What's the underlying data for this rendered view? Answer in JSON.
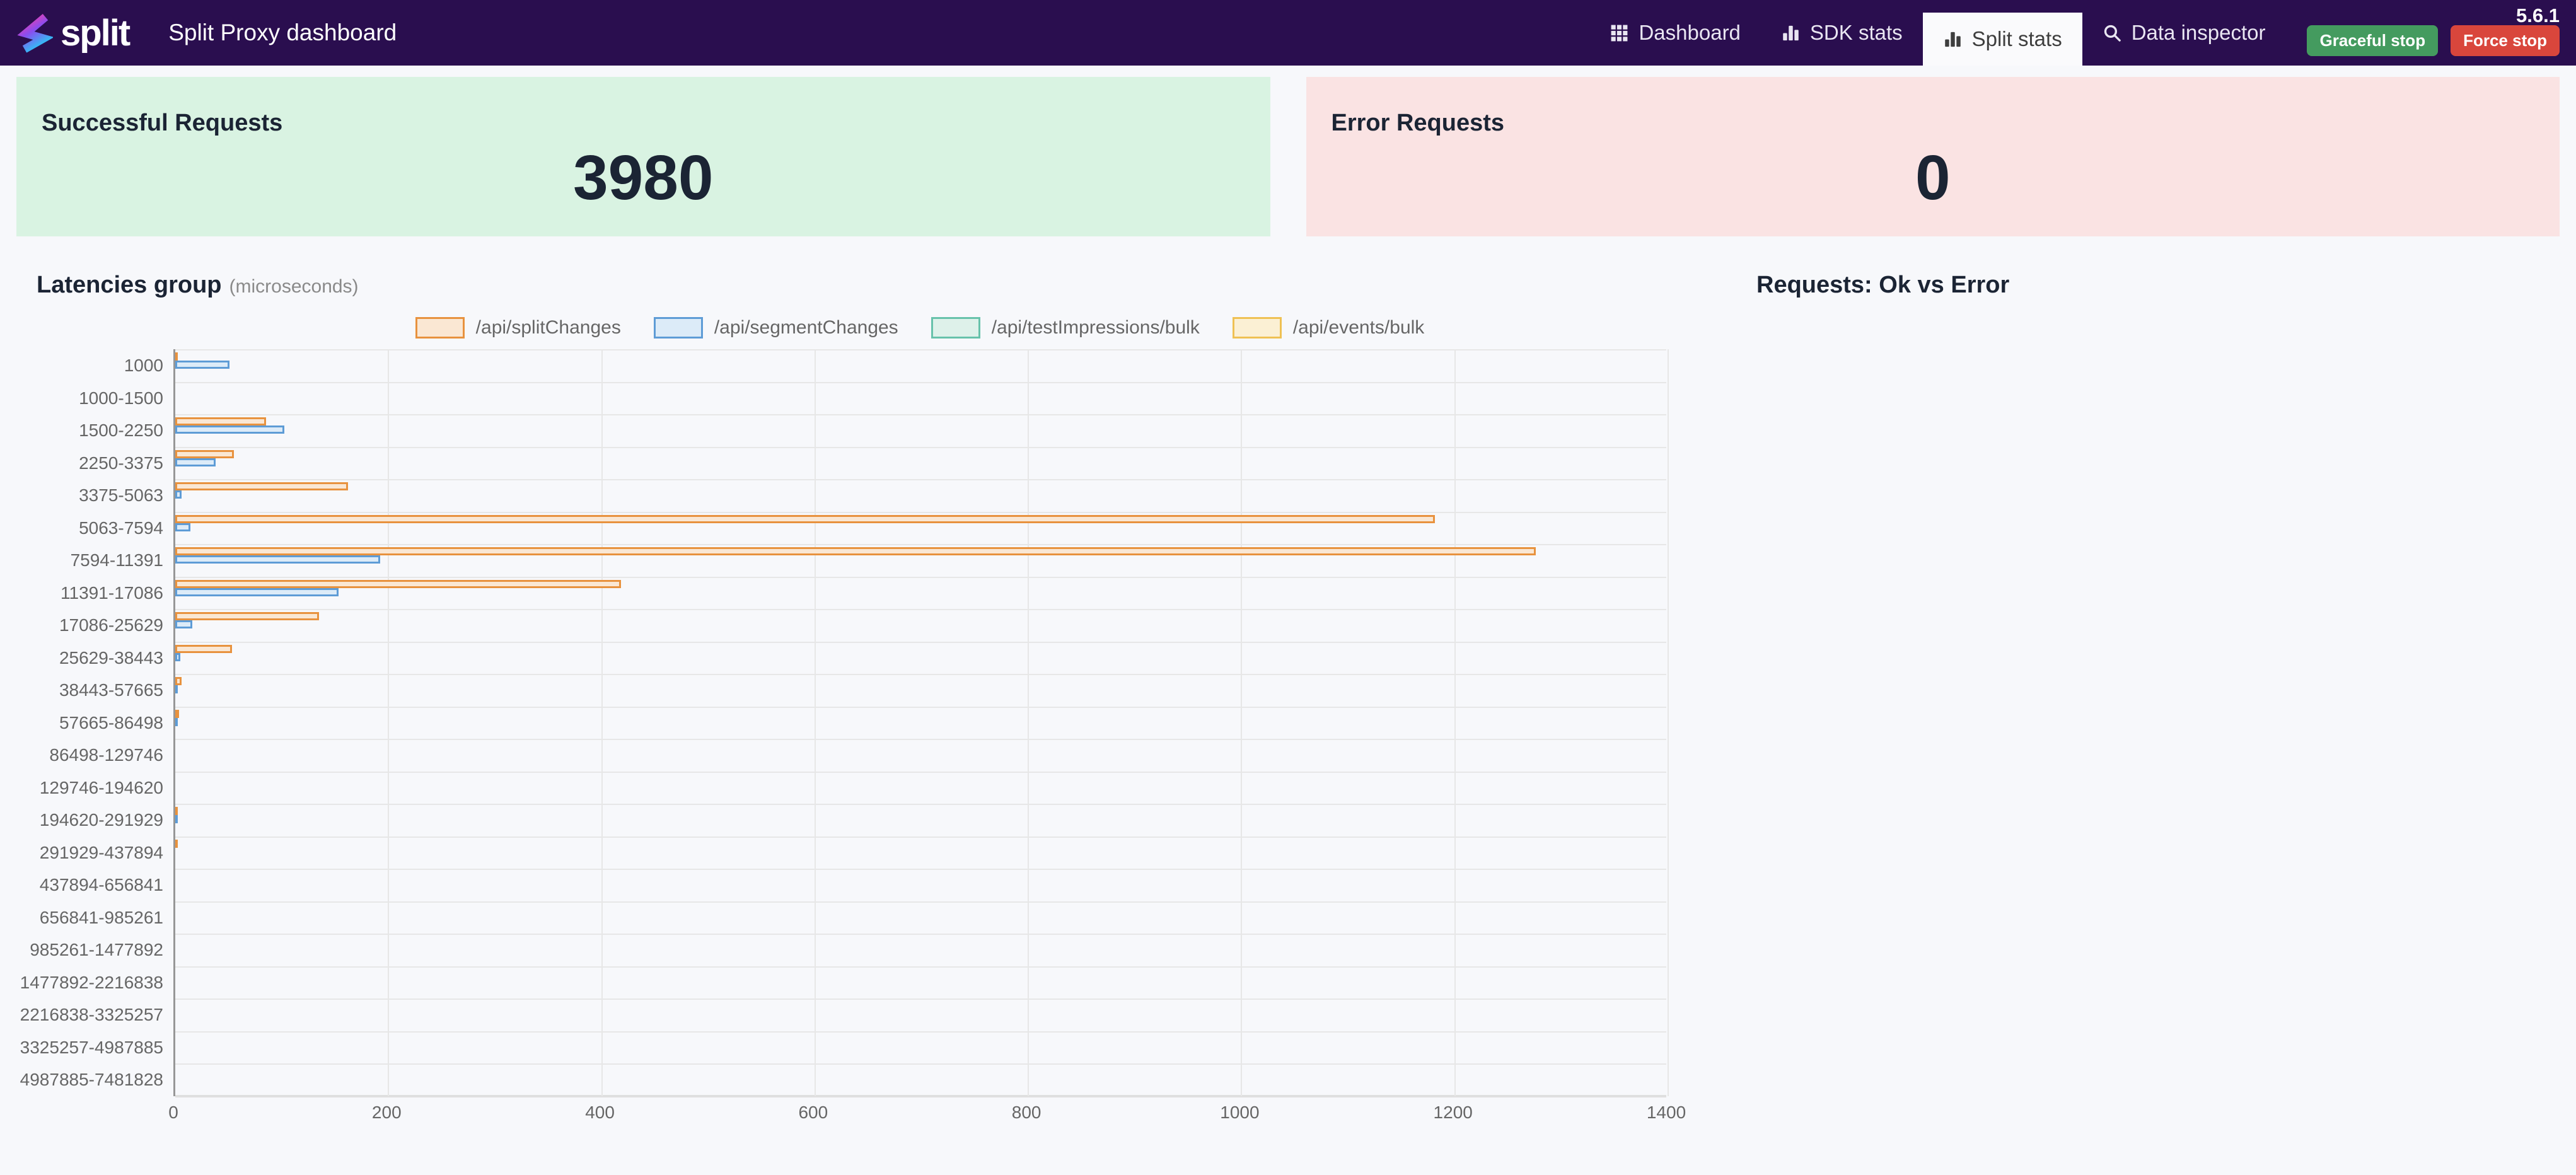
{
  "colors": {
    "header_bg": "#2A0E4F",
    "active_tab_bg": "#FAFAFC",
    "page_bg": "#F7F8FB",
    "success_bg": "#D9F3E2",
    "error_bg": "#FAE3E3",
    "text_dark": "#1B2434",
    "muted_text": "#666666",
    "version_text": "#FFFFFF",
    "graceful_bg": "#449B5F",
    "force_bg": "#D9463C",
    "axis_line": "#979797",
    "grid_line": "#E7E7E7"
  },
  "header": {
    "logo_text": "split",
    "title": "Split Proxy dashboard",
    "version": "5.6.1",
    "nav": [
      {
        "label": "Dashboard",
        "icon": "grid-icon",
        "active": false
      },
      {
        "label": "SDK stats",
        "icon": "bar-chart-icon",
        "active": false
      },
      {
        "label": "Split stats",
        "icon": "bar-chart-icon",
        "active": true
      },
      {
        "label": "Data inspector",
        "icon": "search-icon",
        "active": false
      }
    ],
    "buttons": {
      "graceful": "Graceful stop",
      "force": "Force stop"
    }
  },
  "cards": {
    "success": {
      "title": "Successful Requests",
      "value": "3980"
    },
    "error": {
      "title": "Error Requests",
      "value": "0"
    }
  },
  "chart_data": [
    {
      "type": "bar",
      "orientation": "horizontal",
      "title": "Latencies group",
      "subtitle": "(microseconds)",
      "legend_position": "top",
      "grid": true,
      "xlim": [
        0,
        1400
      ],
      "x_ticks": [
        0,
        200,
        400,
        600,
        800,
        1000,
        1200,
        1400
      ],
      "categories": [
        "1000",
        "1000-1500",
        "1500-2250",
        "2250-3375",
        "3375-5063",
        "5063-7594",
        "7594-11391",
        "11391-17086",
        "17086-25629",
        "25629-38443",
        "38443-57665",
        "57665-86498",
        "86498-129746",
        "129746-194620",
        "194620-291929",
        "291929-437894",
        "437894-656841",
        "656841-985261",
        "985261-1477892",
        "1477892-2216838",
        "2216838-3325257",
        "3325257-4987885",
        "4987885-7481828"
      ],
      "series": [
        {
          "name": "/api/splitChanges",
          "border": "#E8923E",
          "fill": "#FAE7D3",
          "values": [
            2,
            0,
            85,
            55,
            162,
            1181,
            1276,
            418,
            135,
            53,
            6,
            3,
            0,
            0,
            2,
            1,
            0,
            0,
            0,
            0,
            0,
            0,
            0
          ]
        },
        {
          "name": "/api/segmentChanges",
          "border": "#5E9CD6",
          "fill": "#DCEBF8",
          "values": [
            51,
            0,
            102,
            38,
            6,
            14,
            192,
            153,
            16,
            5,
            1,
            1,
            0,
            0,
            1,
            0,
            0,
            0,
            0,
            0,
            0,
            0,
            0
          ]
        },
        {
          "name": "/api/testImpressions/bulk",
          "border": "#67C2AB",
          "fill": "#DEF1EA",
          "values": [
            0,
            0,
            0,
            0,
            0,
            0,
            0,
            0,
            0,
            0,
            0,
            0,
            0,
            0,
            0,
            0,
            0,
            0,
            0,
            0,
            0,
            0,
            0
          ]
        },
        {
          "name": "/api/events/bulk",
          "border": "#EFC153",
          "fill": "#FBF0D4",
          "values": [
            0,
            0,
            0,
            0,
            0,
            0,
            0,
            0,
            0,
            0,
            0,
            0,
            0,
            0,
            0,
            0,
            0,
            0,
            0,
            0,
            0,
            0,
            0
          ]
        }
      ]
    },
    {
      "type": "bar",
      "title": "Requests: Ok vs Error",
      "categories": [],
      "series": []
    }
  ]
}
